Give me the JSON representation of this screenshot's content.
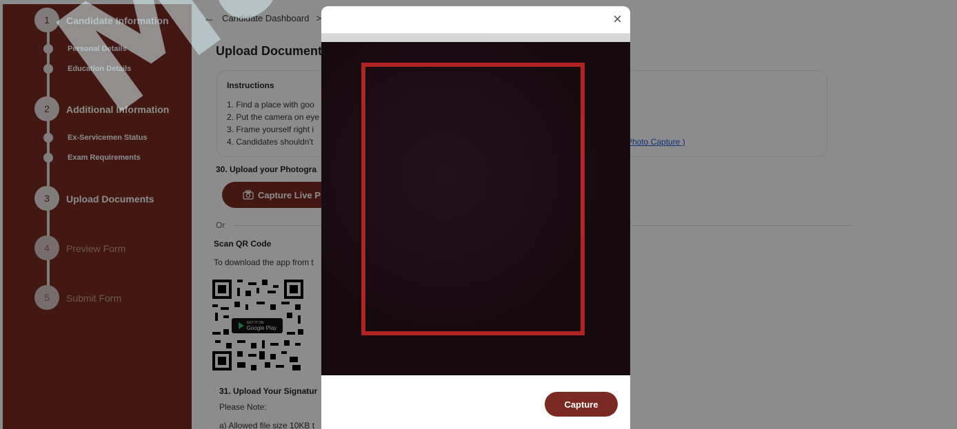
{
  "sidebar": {
    "steps": [
      {
        "number": "1",
        "label": "Candidate Information"
      },
      {
        "number": "2",
        "label": "Additional Information"
      },
      {
        "number": "3",
        "label": "Upload Documents"
      },
      {
        "number": "4",
        "label": "Preview Form"
      },
      {
        "number": "5",
        "label": "Submit Form"
      }
    ],
    "substeps": [
      {
        "label": "Personal Details"
      },
      {
        "label": "Education Details"
      },
      {
        "label": "Ex-Servicemen Status"
      },
      {
        "label": "Exam Requirements"
      }
    ]
  },
  "main": {
    "breadcrumb": {
      "item": "Candidate Dashboard",
      "separator": ">"
    },
    "title": "Upload Document",
    "instructions": {
      "heading": "Instructions",
      "items": [
        "1. Find a place with goo",
        "2. Put the camera on eye",
        "3. Frame yourself right i",
        "4. Candidates shouldn't "
      ],
      "link": "Photo Capture )"
    },
    "q30": "30. Upload your Photogra",
    "capture_live": "Capture Live Ph",
    "or": "Or",
    "scan_qr": "Scan QR Code",
    "download_text": "To download the app from t",
    "gplay_small": "GET IT ON",
    "gplay": "Google Play",
    "q31": "31. Upload Your Signatur",
    "note": "Please Note:",
    "filesize": "a) Allowed file size 10KB t"
  },
  "watermark": "Mahab",
  "modal": {
    "close": "×",
    "capture_button": "Capture"
  },
  "colors": {
    "brand": "#7a2a22",
    "frame": "#b12424",
    "link": "#1a5bd6"
  }
}
